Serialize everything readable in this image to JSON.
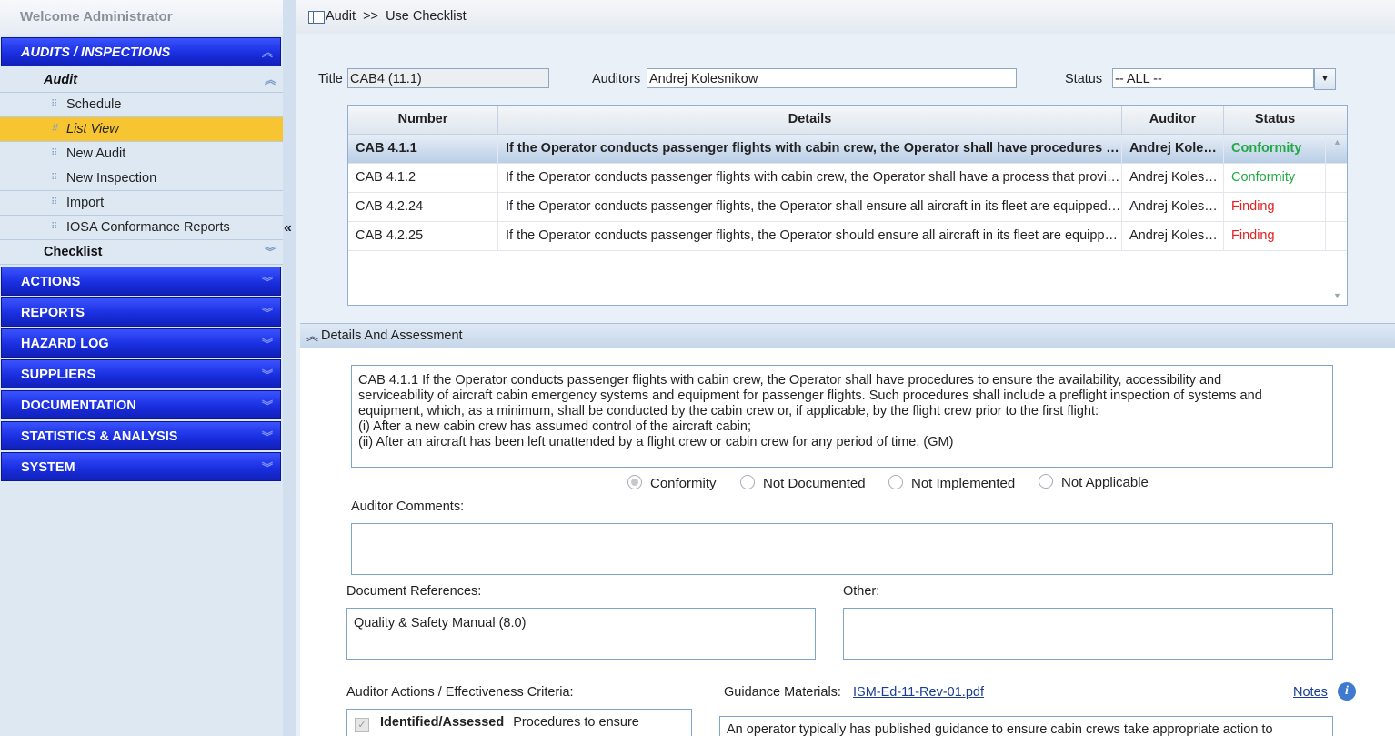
{
  "sidebar": {
    "welcome": "Welcome  Administrator",
    "top_section": "AUDITS / INSPECTIONS",
    "audit_header": "Audit",
    "items": [
      {
        "label": "Schedule"
      },
      {
        "label": "List View"
      },
      {
        "label": "New Audit"
      },
      {
        "label": "New Inspection"
      },
      {
        "label": "Import"
      },
      {
        "label": "IOSA Conformance Reports"
      }
    ],
    "checklist_header": "Checklist",
    "sections": [
      "ACTIONS",
      "REPORTS",
      "HAZARD LOG",
      "SUPPLIERS",
      "DOCUMENTATION",
      "STATISTICS & ANALYSIS",
      "SYSTEM"
    ]
  },
  "breadcrumb": {
    "root": "Audit",
    "sep": ">>",
    "page": "Use Checklist"
  },
  "filters": {
    "title_label": "Title",
    "title_value": "CAB4 (11.1)",
    "auditors_label": "Auditors",
    "auditors_value": "Andrej Kolesnikow",
    "status_label": "Status",
    "status_value": "-- ALL --"
  },
  "grid": {
    "headers": [
      "Number",
      "Details",
      "Auditor",
      "Status"
    ],
    "rows": [
      {
        "number": "CAB 4.1.1",
        "details": "If the Operator conducts passenger flights with cabin crew, the Operator shall have procedures to ensure the availability, accessibility and serviceability of aircraft cabin emergency systems",
        "auditor": "Andrej Kolesnikow",
        "status": "Conformity"
      },
      {
        "number": "CAB 4.1.2",
        "details": "If the Operator conducts passenger flights with cabin crew, the Operator shall have a process that provides for the reporting and correction of defects",
        "auditor": "Andrej Kolesnikow",
        "status": "Conformity"
      },
      {
        "number": "CAB 4.2.24",
        "details": "If the Operator conducts passenger flights, the Operator shall ensure all aircraft in its fleet are equipped with",
        "auditor": "Andrej Kolesnikow",
        "status": "Finding"
      },
      {
        "number": "CAB 4.2.25",
        "details": "If the Operator conducts passenger flights, the Operator should ensure all aircraft in its fleet are equipped with",
        "auditor": "Andrej Kolesnikow",
        "status": "Finding"
      }
    ]
  },
  "details_panel": {
    "title": "Details And Assessment",
    "description_lines": [
      "CAB 4.1.1 If the Operator conducts passenger flights with cabin crew, the Operator shall have procedures to ensure the availability, accessibility and",
      "serviceability of aircraft cabin emergency systems and equipment for passenger flights. Such procedures shall include a preflight inspection of systems and",
      "equipment, which, as a minimum, shall be conducted by the cabin crew or, if applicable, by the flight crew prior to the first flight:",
      "(i) After a new cabin crew has assumed control of the aircraft cabin;",
      "(ii) After an aircraft has been left unattended by a flight crew or cabin crew for any period of time. (GM)"
    ],
    "radios": [
      "Conformity",
      "Not Documented",
      "Not Implemented",
      "Not Applicable"
    ],
    "selected_radio": "Conformity",
    "auditor_comments_label": "Auditor Comments:",
    "auditor_comments_value": "",
    "doc_refs_label": "Document References:",
    "doc_refs_value": "Quality & Safety Manual (8.0)",
    "other_label": "Other:",
    "other_value": "",
    "actions_label": "Auditor Actions / Effectiveness Criteria:",
    "actions_check_label": "Identified/Assessed",
    "actions_check_text": "Procedures to ensure",
    "guidance_label": "Guidance Materials:",
    "guidance_link": "ISM-Ed-11-Rev-01.pdf",
    "notes_link": "Notes",
    "guidance_text": "An operator typically has published guidance to ensure cabin crews take appropriate action to"
  }
}
